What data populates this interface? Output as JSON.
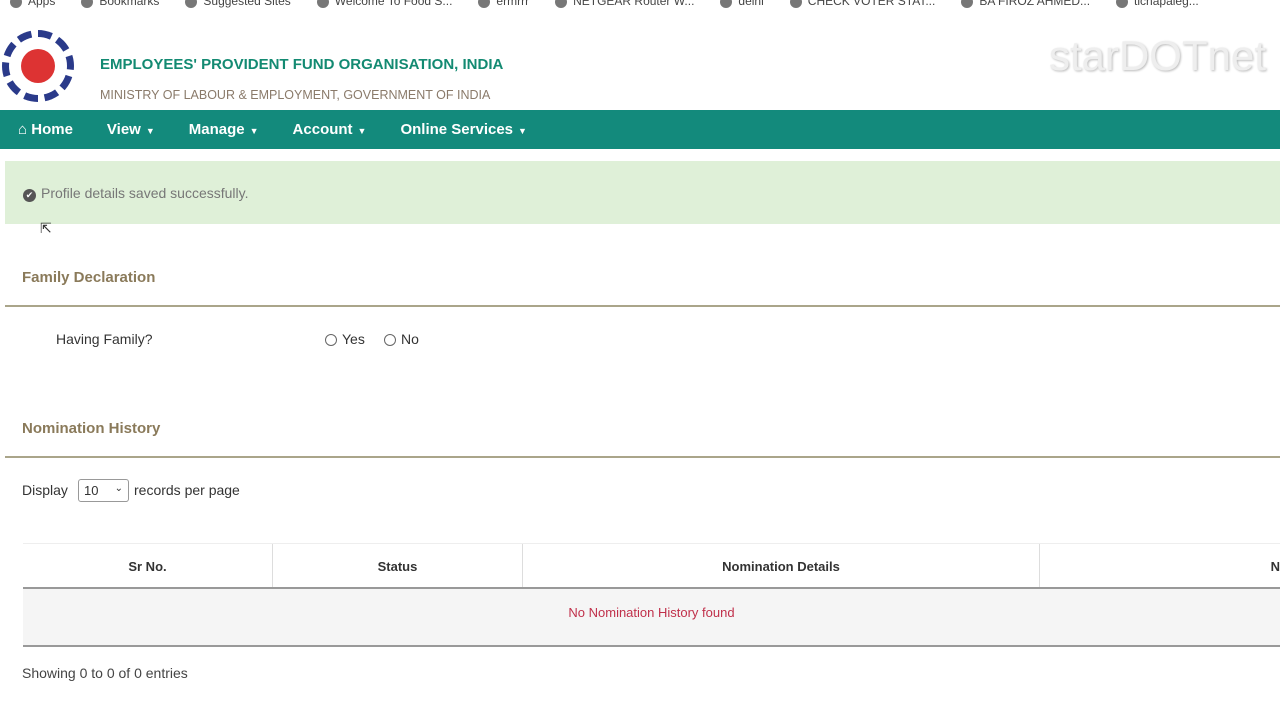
{
  "bookmarks": [
    "Apps",
    "Bookmarks",
    "Suggested Sites",
    "Welcome To Food S...",
    "ermrrr",
    "NETGEAR Router W...",
    "delhi",
    "CHECK VOTER STAT...",
    "BA FIROZ AHMED...",
    "tichapaleg..."
  ],
  "header": {
    "title": "EMPLOYEES' PROVIDENT FUND ORGANISATION, INDIA",
    "subtitle": "MINISTRY OF LABOUR & EMPLOYMENT, GOVERNMENT OF INDIA",
    "watermark": "starDOTnet"
  },
  "nav": {
    "home": "Home",
    "view": "View",
    "manage": "Manage",
    "account": "Account",
    "online_services": "Online Services"
  },
  "alert": {
    "message": "Profile details saved successfully."
  },
  "family": {
    "heading": "Family Declaration",
    "question": "Having Family?",
    "yes": "Yes",
    "no": "No"
  },
  "history": {
    "heading": "Nomination History",
    "display": "Display",
    "page_size": "10",
    "per_page": "records per page",
    "columns": [
      "Sr No.",
      "Status",
      "Nomination Details",
      "N"
    ],
    "empty": "No Nomination History found",
    "showing": "Showing 0 to 0 of 0 entries"
  }
}
